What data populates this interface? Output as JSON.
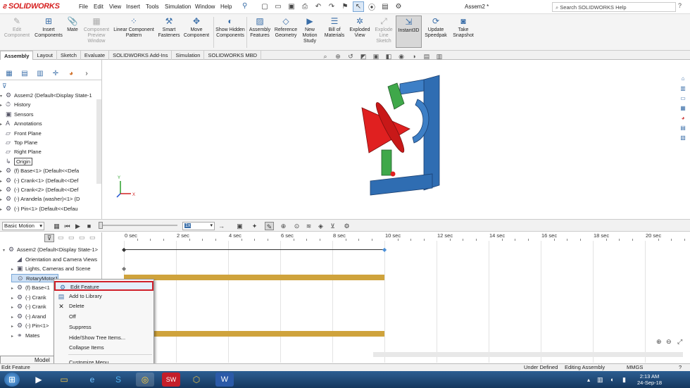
{
  "app": {
    "logo": "SOLIDWORKS",
    "document_title": "Assem2 *",
    "search_placeholder": "Search SOLIDWORKS Help"
  },
  "menu": [
    "File",
    "Edit",
    "View",
    "Insert",
    "Tools",
    "Simulation",
    "Window",
    "Help"
  ],
  "ribbon": [
    {
      "label": "Edit Component",
      "icon": "edit-component-icon",
      "disabled": true
    },
    {
      "label": "Insert Components",
      "icon": "insert-components-icon",
      "disabled": false
    },
    {
      "label": "Mate",
      "icon": "mate-icon",
      "disabled": false
    },
    {
      "label": "Component Preview Window",
      "icon": "preview-window-icon",
      "disabled": true
    },
    {
      "label": "Linear Component Pattern",
      "icon": "linear-pattern-icon",
      "disabled": false
    },
    {
      "label": "Smart Fasteners",
      "icon": "smart-fasteners-icon",
      "disabled": false
    },
    {
      "label": "Move Component",
      "icon": "move-component-icon",
      "disabled": false
    },
    {
      "label": "Show Hidden Components",
      "icon": "show-hidden-icon",
      "disabled": false
    },
    {
      "label": "Assembly Features",
      "icon": "assembly-features-icon",
      "disabled": false
    },
    {
      "label": "Reference Geometry",
      "icon": "reference-geometry-icon",
      "disabled": false
    },
    {
      "label": "New Motion Study",
      "icon": "new-motion-study-icon",
      "disabled": false
    },
    {
      "label": "Bill of Materials",
      "icon": "bill-of-materials-icon",
      "disabled": false
    },
    {
      "label": "Exploded View",
      "icon": "exploded-view-icon",
      "disabled": false
    },
    {
      "label": "Explode Line Sketch",
      "icon": "explode-line-icon",
      "disabled": true
    },
    {
      "label": "Instant3D",
      "icon": "instant3d-icon",
      "disabled": false,
      "active": true
    },
    {
      "label": "Update Speedpak",
      "icon": "speedpak-icon",
      "disabled": false
    },
    {
      "label": "Take Snapshot",
      "icon": "snapshot-icon",
      "disabled": false
    }
  ],
  "command_tabs": [
    "Assembly",
    "Layout",
    "Sketch",
    "Evaluate",
    "SOLIDWORKS Add-Ins",
    "Simulation",
    "SOLIDWORKS MBD"
  ],
  "feature_tree": [
    {
      "label": "Assem2  (Default<Display State-1",
      "level": 0,
      "expand": "▾"
    },
    {
      "label": "History",
      "level": 1,
      "expand": "▸"
    },
    {
      "label": "Sensors",
      "level": 1,
      "expand": ""
    },
    {
      "label": "Annotations",
      "level": 1,
      "expand": "▸"
    },
    {
      "label": "Front Plane",
      "level": 1,
      "expand": ""
    },
    {
      "label": "Top Plane",
      "level": 1,
      "expand": ""
    },
    {
      "label": "Right Plane",
      "level": 1,
      "expand": ""
    },
    {
      "label": "Origin",
      "level": 1,
      "expand": "",
      "boxed": true
    },
    {
      "label": "(f) Base<1> (Default<<Defa",
      "level": 1,
      "expand": "▸"
    },
    {
      "label": "(-) Crank<1> (Default<<Def",
      "level": 1,
      "expand": "▸"
    },
    {
      "label": "(-) Crank<2> (Default<<Def",
      "level": 1,
      "expand": "▸"
    },
    {
      "label": "(-) Arandela (washer)<1> (D",
      "level": 1,
      "expand": "▸"
    },
    {
      "label": "(-) Pin<1> (Default<<Defau",
      "level": 1,
      "expand": "▸"
    }
  ],
  "motion": {
    "study_type": "Basic Motion",
    "speed_value": "1x",
    "time_labels": [
      "0 sec",
      "2 sec",
      "4 sec",
      "6 sec",
      "8 sec",
      "10 sec",
      "12 sec",
      "14 sec",
      "16 sec",
      "18 sec",
      "20 sec"
    ],
    "tree": [
      {
        "label": "Assem2  (Default<Display State-1>",
        "expand": "▾"
      },
      {
        "label": "Orientation and Camera Views",
        "expand": ""
      },
      {
        "label": "Lights, Cameras and Scene",
        "expand": "▸"
      },
      {
        "label": "RotaryMotor1",
        "expand": ""
      },
      {
        "label": "(f) Base<1",
        "expand": "▸"
      },
      {
        "label": "(-) Crank",
        "expand": "▸"
      },
      {
        "label": "(-) Crank",
        "expand": "▸"
      },
      {
        "label": "(-) Arand",
        "expand": "▸"
      },
      {
        "label": "(-) Pin<1>",
        "expand": "▸"
      },
      {
        "label": "Mates",
        "expand": "▸"
      }
    ],
    "tabs": [
      "Model"
    ]
  },
  "context_menu": [
    {
      "label": "Edit Feature",
      "icon": "edit-feature-icon",
      "highlighted": true
    },
    {
      "label": "Add to Library",
      "icon": "add-library-icon"
    },
    {
      "label": "Delete",
      "icon": "delete-icon"
    },
    {
      "label": "Off",
      "icon": ""
    },
    {
      "label": "Suppress",
      "icon": ""
    },
    {
      "label": "Hide/Show Tree Items...",
      "icon": ""
    },
    {
      "label": "Collapse Items",
      "icon": ""
    },
    {
      "label": "Customize Menu",
      "icon": ""
    }
  ],
  "status": {
    "left": "Edit Feature",
    "under_defined": "Under Defined",
    "mode": "Editing Assembly",
    "units": "MMGS"
  },
  "taskbar": {
    "time": "2:13 AM",
    "date": "24-Sep-18"
  },
  "colors": {
    "accent": "#3a6ea8",
    "highlight_border": "#d0202a",
    "timeline_bar": "#cfa33c",
    "part_red": "#e02020",
    "part_blue": "#2f6db2",
    "part_green": "#3fa84a"
  }
}
